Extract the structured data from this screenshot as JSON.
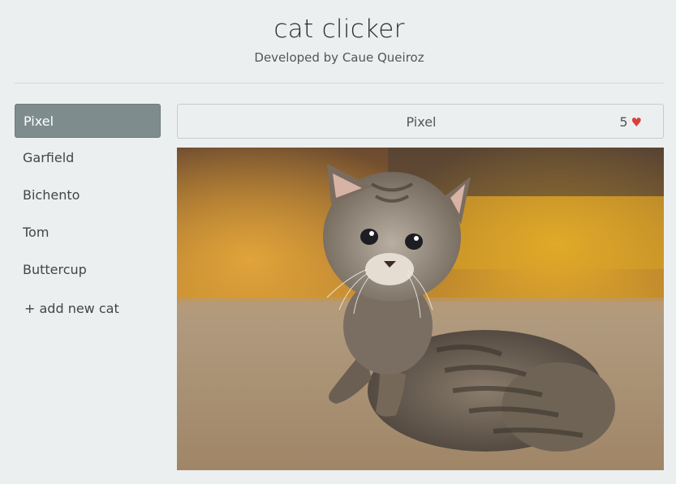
{
  "app": {
    "title": "cat clicker",
    "subtitle": "Developed by Caue Queiroz"
  },
  "sidebar": {
    "items": [
      {
        "label": "Pixel",
        "active": true
      },
      {
        "label": "Garfield",
        "active": false
      },
      {
        "label": "Bichento",
        "active": false
      },
      {
        "label": "Tom",
        "active": false
      },
      {
        "label": "Buttercup",
        "active": false
      }
    ],
    "add_label": "+ add new cat"
  },
  "selected_cat": {
    "name": "Pixel",
    "clicks": "5",
    "heart_icon": "heart-icon",
    "heart_color": "#d9403a"
  },
  "colors": {
    "background": "#eceff0",
    "active_item": "#7f8c8d"
  }
}
